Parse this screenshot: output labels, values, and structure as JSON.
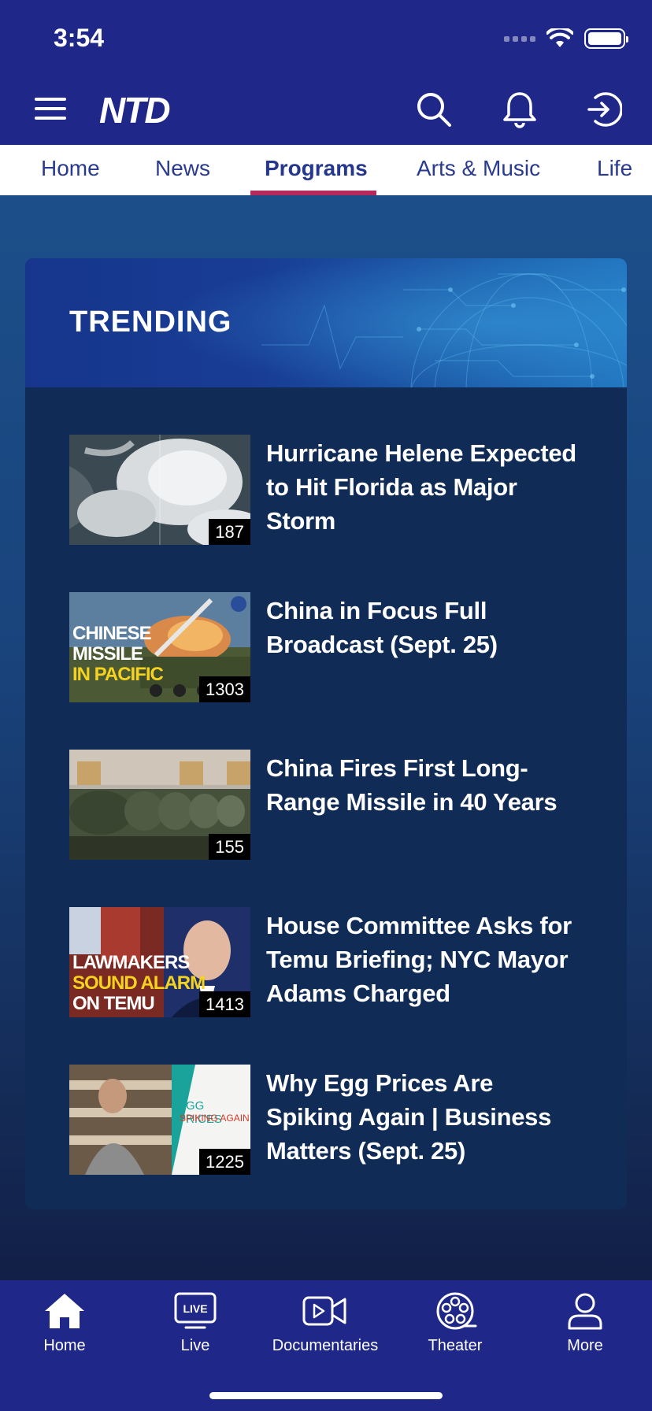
{
  "status_bar": {
    "time": "3:54"
  },
  "header": {
    "logo": "NTD",
    "menu_icon": "hamburger-menu-icon",
    "search_icon": "search-icon",
    "bell_icon": "bell-icon",
    "login_icon": "sign-in-icon"
  },
  "tabs": [
    {
      "label": "Home"
    },
    {
      "label": "News"
    },
    {
      "label": "Programs",
      "active": true
    },
    {
      "label": "Arts & Music"
    },
    {
      "label": "Life"
    }
  ],
  "trending": {
    "title": "TRENDING",
    "items": [
      {
        "title": "Hurricane Helene Expected to Hit Florida as Major Storm",
        "count": "187"
      },
      {
        "title": "China in Focus Full Broadcast (Sept. 25)",
        "count": "1303",
        "thumb_text": [
          "CHINESE",
          "MISSILE",
          "IN PACIFIC"
        ]
      },
      {
        "title": "China Fires First Long-Range Missile in 40 Years",
        "count": "155"
      },
      {
        "title": "House Committee Asks for Temu Briefing; NYC Mayor Adams Charged",
        "count": "1413",
        "thumb_text": [
          "LAWMAKERS",
          "SOUND ALARM",
          "ON TEMU"
        ]
      },
      {
        "title": "Why Egg Prices Are Spiking Again | Business Matters (Sept. 25)",
        "count": "1225",
        "thumb_text": [
          "EGG PRICES",
          "SPIKING AGAIN"
        ]
      }
    ]
  },
  "bottom_nav": [
    {
      "label": "Home",
      "icon": "home-icon"
    },
    {
      "label": "Live",
      "icon": "live-tv-icon",
      "icon_text": "LIVE"
    },
    {
      "label": "Documentaries",
      "icon": "video-camera-icon"
    },
    {
      "label": "Theater",
      "icon": "film-reel-icon"
    },
    {
      "label": "More",
      "icon": "person-icon"
    }
  ],
  "colors": {
    "header_bg": "#1f2788",
    "tab_active_underline": "#b52a5a",
    "card_bg": "#0f2b56"
  }
}
